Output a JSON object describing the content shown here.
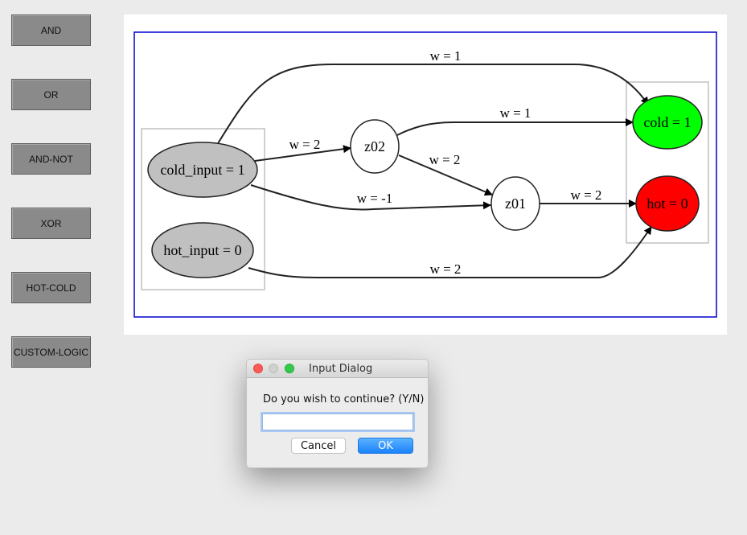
{
  "sidebar": {
    "buttons": [
      {
        "label": "AND"
      },
      {
        "label": "OR"
      },
      {
        "label": "AND-NOT"
      },
      {
        "label": "XOR"
      },
      {
        "label": "HOT-COLD"
      },
      {
        "label": "CUSTOM-LOGIC"
      }
    ]
  },
  "graph": {
    "nodes": {
      "cold_input": "cold_input = 1",
      "hot_input": "hot_input = 0",
      "z02": "z02",
      "z01": "z01",
      "cold": "cold = 1",
      "hot": "hot = 0"
    },
    "edges": {
      "cold_input_to_cold": "w = 1",
      "z02_to_cold": "w = 1",
      "cold_input_to_z02": "w = 2",
      "z02_to_z01": "w = 2",
      "cold_input_to_z01": "w = -1",
      "z01_to_hot": "w = 2",
      "hot_input_to_hot": "w = 2"
    },
    "colors": {
      "input_node_fill": "#c0c0c0",
      "output_true_fill": "#00ff00",
      "output_false_fill": "#ff0000",
      "frame_border": "#0000cc",
      "cluster_border": "#c0c0c0"
    }
  },
  "dialog": {
    "title": "Input Dialog",
    "prompt": "Do you wish to continue? (Y/N)",
    "input_value": "",
    "cancel_label": "Cancel",
    "ok_label": "OK"
  }
}
